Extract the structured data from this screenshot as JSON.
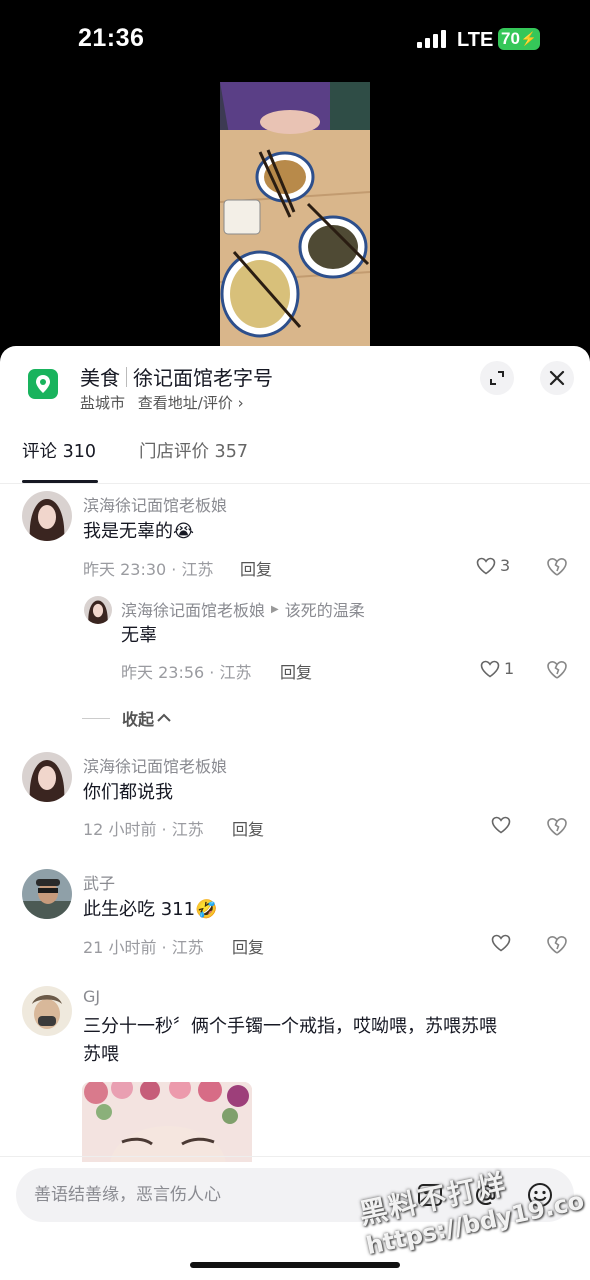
{
  "status_bar": {
    "time": "21:36",
    "network": "LTE",
    "battery": "70"
  },
  "place": {
    "category": "美食",
    "name": "徐记面馆老字号",
    "city": "盐城市",
    "link": "查看地址/评价 ›"
  },
  "tabs": [
    {
      "label": "评论 310",
      "active": true
    },
    {
      "label": "门店评价 357",
      "active": false
    }
  ],
  "comments": [
    {
      "author": "滨海徐记面馆老板娘",
      "text": "我是无辜的😭",
      "time_loc": "昨天 23:30 · 江苏",
      "reply": "回复",
      "likes": "3",
      "replies": [
        {
          "author": "滨海徐记面馆老板娘",
          "reply_to": "该死的温柔",
          "text": "无辜",
          "time_loc": "昨天 23:56 · 江苏",
          "reply": "回复",
          "likes": "1"
        }
      ],
      "collapse_label": "收起"
    },
    {
      "author": "滨海徐记面馆老板娘",
      "text": "你们都说我",
      "time_loc": "12 小时前 · 江苏",
      "reply": "回复",
      "likes": ""
    },
    {
      "author": "武子",
      "text": "此生必吃 311🤣",
      "time_loc": "21 小时前 · 江苏",
      "reply": "回复",
      "likes": ""
    },
    {
      "author": "GJ",
      "text_line1": "三分十一秒〞俩个手镯一个戒指，哎呦喂，苏喂苏喂",
      "text_line2": "苏喂"
    }
  ],
  "input": {
    "placeholder": "善语结善缘，恶言伤人心"
  },
  "watermark": {
    "text": "黑料不打烊",
    "url": "https://bdy19.co"
  },
  "colors": {
    "accent_green": "#19b35d",
    "battery_green": "#35c759",
    "text_primary": "#161823",
    "text_secondary": "#8a8b91"
  },
  "icons": [
    "location-pin-icon",
    "expand-icon",
    "close-icon",
    "heart-icon",
    "broken-heart-icon",
    "image-icon",
    "at-icon",
    "emoji-icon"
  ]
}
